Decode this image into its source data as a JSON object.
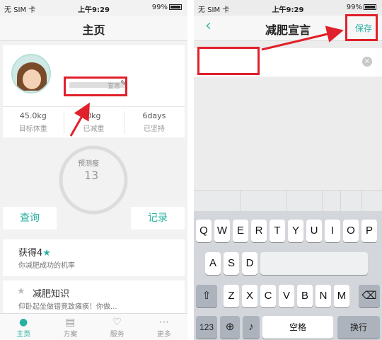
{
  "left": {
    "status": {
      "carrier": "无 SIM 卡",
      "time": "上午9:29",
      "battery": "99%"
    },
    "nav_title": "主页",
    "profile": {
      "slogan": "宣言"
    },
    "stats": [
      {
        "value": "45.0kg",
        "label": "目标体重"
      },
      {
        "value": "0kg",
        "label": "已减重"
      },
      {
        "value": "6days",
        "label": "已坚持"
      }
    ],
    "gauge": {
      "label": "预测瘦",
      "value": "13"
    },
    "buttons": {
      "query": "查询",
      "record": "记录"
    },
    "achievement": {
      "title": "获得4",
      "subtitle": "你减肥成功的机率"
    },
    "knowledge": {
      "title": "减肥知识",
      "subtitle": "仰卧起坐做错竟致瘫痪！你做..."
    },
    "tabs": [
      {
        "label": "主页",
        "icon": "person-icon"
      },
      {
        "label": "方案",
        "icon": "document-icon"
      },
      {
        "label": "服务",
        "icon": "heart-icon"
      },
      {
        "label": "更多",
        "icon": "more-icon"
      }
    ],
    "accent": "#2ab0a0"
  },
  "right": {
    "status": {
      "carrier": "无 SIM 卡",
      "time": "上午9:29",
      "battery": "99%"
    },
    "nav_title": "减肥宣言",
    "save_label": "保存",
    "input": {
      "value": "",
      "placeholder": ""
    },
    "keyboard": {
      "row1": [
        "Q",
        "W",
        "E",
        "R",
        "T",
        "Y",
        "U",
        "I",
        "O",
        "P"
      ],
      "row2": [
        "A",
        "S",
        "D"
      ],
      "row3": [
        "Z",
        "X",
        "C",
        "V",
        "B",
        "N",
        "M"
      ],
      "row4": {
        "numbers": "123",
        "space": "空格",
        "return": "换行"
      }
    }
  },
  "annotation_color": "#e0202a"
}
